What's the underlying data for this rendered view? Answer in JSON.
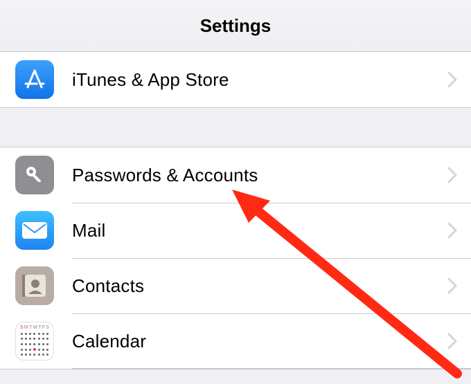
{
  "header": {
    "title": "Settings"
  },
  "group1": {
    "items": [
      {
        "label": "iTunes & App Store",
        "icon": "appstore-icon"
      }
    ]
  },
  "group2": {
    "items": [
      {
        "label": "Passwords & Accounts",
        "icon": "key-icon"
      },
      {
        "label": "Mail",
        "icon": "mail-icon"
      },
      {
        "label": "Contacts",
        "icon": "contacts-icon"
      },
      {
        "label": "Calendar",
        "icon": "calendar-icon"
      }
    ]
  },
  "annotation": {
    "target": "Passwords & Accounts",
    "color": "#ff2a14"
  }
}
